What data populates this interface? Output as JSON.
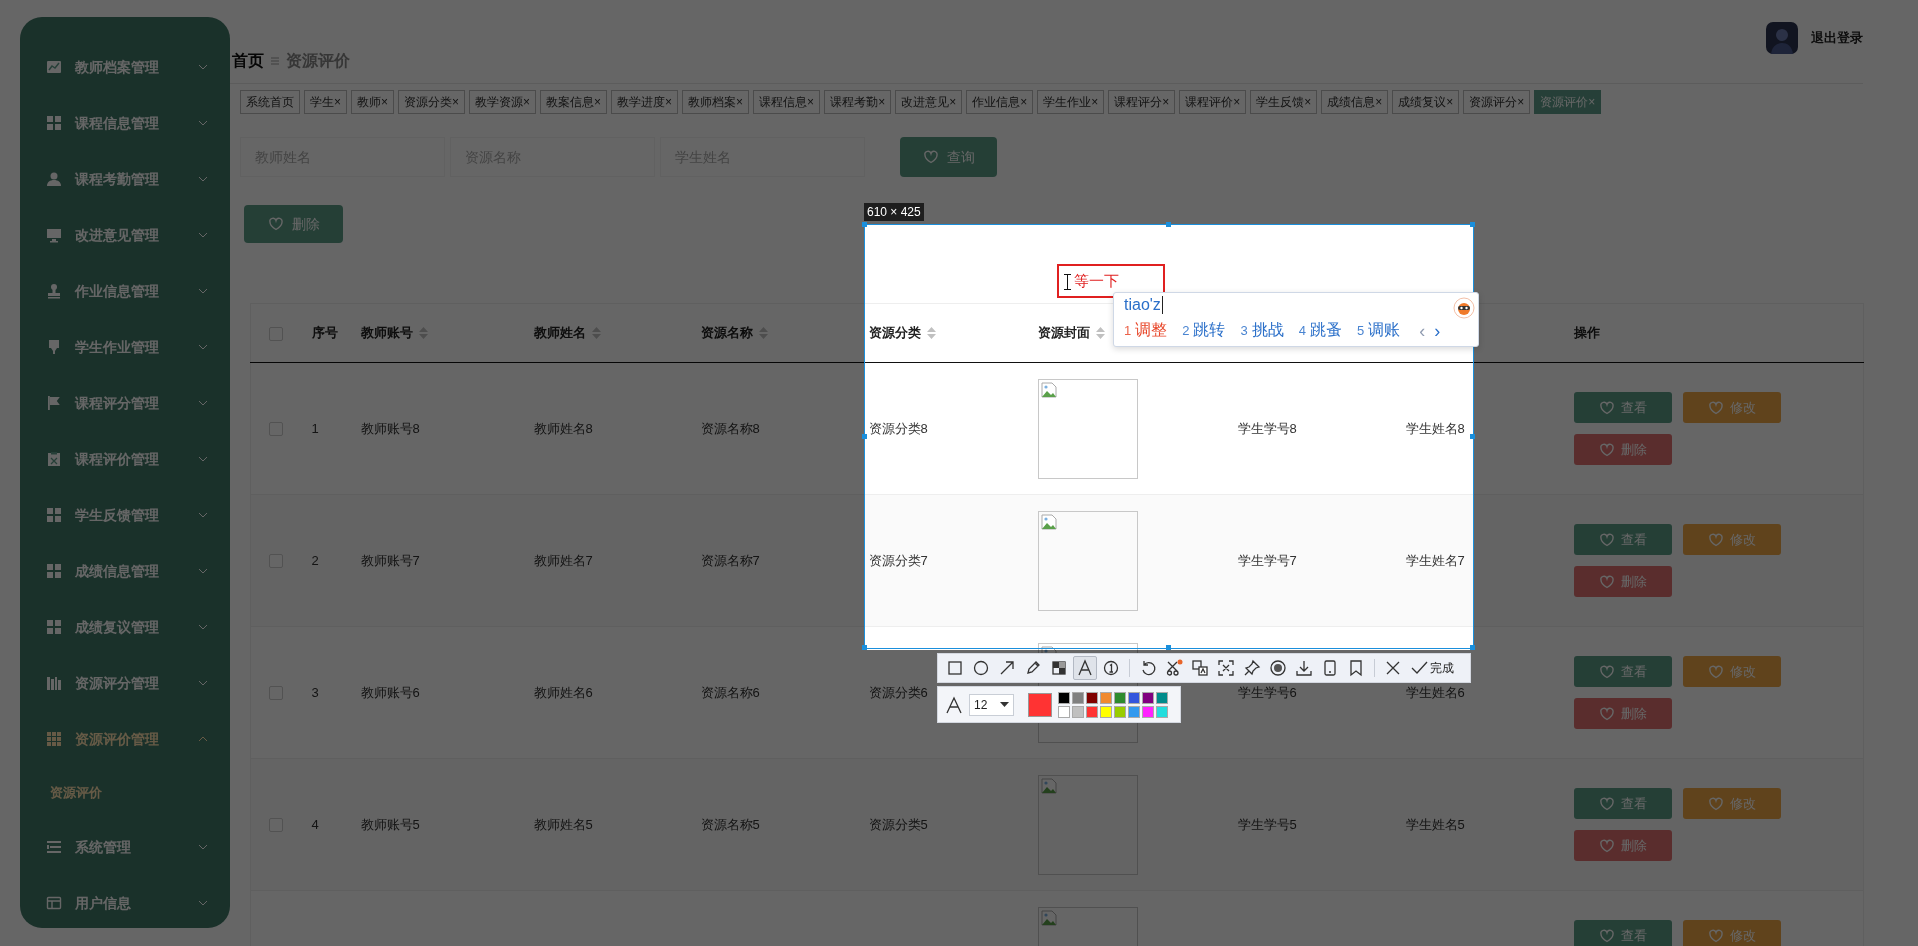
{
  "sidebar": {
    "items": [
      {
        "label": "教师档案管理",
        "expanded": false,
        "selected": false
      },
      {
        "label": "课程信息管理",
        "expanded": false,
        "selected": false
      },
      {
        "label": "课程考勤管理",
        "expanded": false,
        "selected": false
      },
      {
        "label": "改进意见管理",
        "expanded": false,
        "selected": false
      },
      {
        "label": "作业信息管理",
        "expanded": false,
        "selected": false
      },
      {
        "label": "学生作业管理",
        "expanded": false,
        "selected": false
      },
      {
        "label": "课程评分管理",
        "expanded": false,
        "selected": false
      },
      {
        "label": "课程评价管理",
        "expanded": false,
        "selected": false
      },
      {
        "label": "学生反馈管理",
        "expanded": false,
        "selected": false
      },
      {
        "label": "成绩信息管理",
        "expanded": false,
        "selected": false
      },
      {
        "label": "成绩复议管理",
        "expanded": false,
        "selected": false
      },
      {
        "label": "资源评分管理",
        "expanded": false,
        "selected": false
      },
      {
        "label": "资源评价管理",
        "expanded": true,
        "selected": true,
        "children": [
          {
            "label": "资源评价",
            "selected": true
          }
        ]
      },
      {
        "label": "系统管理",
        "expanded": false,
        "selected": false
      },
      {
        "label": "用户信息",
        "expanded": false,
        "selected": false
      }
    ]
  },
  "header": {
    "breadcrumb": [
      "首页",
      "资源评价"
    ],
    "logout": "退出登录"
  },
  "tabs": [
    {
      "label": "系统首页",
      "selected": false
    },
    {
      "label": "学生",
      "close": "×",
      "selected": false
    },
    {
      "label": "教师",
      "close": "×",
      "selected": false
    },
    {
      "label": "资源分类",
      "close": "×",
      "selected": false
    },
    {
      "label": "教学资源",
      "close": "×",
      "selected": false
    },
    {
      "label": "教案信息",
      "close": "×",
      "selected": false
    },
    {
      "label": "教学进度",
      "close": "×",
      "selected": false
    },
    {
      "label": "教师档案",
      "close": "×",
      "selected": false
    },
    {
      "label": "课程信息",
      "close": "×",
      "selected": false
    },
    {
      "label": "课程考勤",
      "close": "×",
      "selected": false
    },
    {
      "label": "改进意见",
      "close": "×",
      "selected": false
    },
    {
      "label": "作业信息",
      "close": "×",
      "selected": false
    },
    {
      "label": "学生作业",
      "close": "×",
      "selected": false
    },
    {
      "label": "课程评分",
      "close": "×",
      "selected": false
    },
    {
      "label": "课程评价",
      "close": "×",
      "selected": false
    },
    {
      "label": "学生反馈",
      "close": "×",
      "selected": false
    },
    {
      "label": "成绩信息",
      "close": "×",
      "selected": false
    },
    {
      "label": "成绩复议",
      "close": "×",
      "selected": false
    },
    {
      "label": "资源评分",
      "close": "×",
      "selected": false
    },
    {
      "label": "资源评价",
      "close": "×",
      "selected": true
    }
  ],
  "search": {
    "fields": [
      {
        "placeholder": "教师姓名"
      },
      {
        "placeholder": "资源名称"
      },
      {
        "placeholder": "学生姓名"
      }
    ],
    "button": "查询"
  },
  "delete_button": "删除",
  "table": {
    "checked": false,
    "columns": [
      {
        "label": "序号",
        "sortable": false
      },
      {
        "label": "教师账号",
        "sortable": true
      },
      {
        "label": "教师姓名",
        "sortable": true
      },
      {
        "label": "资源名称",
        "sortable": true
      },
      {
        "label": "资源分类",
        "sortable": true
      },
      {
        "label": "资源封面",
        "sortable": true
      },
      null,
      null,
      {
        "label": "操作",
        "sortable": false
      }
    ],
    "rows": [
      {
        "checked": false,
        "index": "1",
        "teacher_account": "教师账号8",
        "teacher_name": "教师姓名8",
        "resource_name": "资源名称8",
        "category": "资源分类8",
        "student_no": "学生学号8",
        "student_name": "学生姓名8",
        "actions": [
          {
            "kind": "view",
            "label": "查看"
          },
          {
            "kind": "edit",
            "label": "修改"
          },
          {
            "kind": "delete",
            "label": "删除"
          }
        ]
      },
      {
        "checked": false,
        "index": "2",
        "teacher_account": "教师账号7",
        "teacher_name": "教师姓名7",
        "resource_name": "资源名称7",
        "category": "资源分类7",
        "student_no": "学生学号7",
        "student_name": "学生姓名7",
        "actions": [
          {
            "kind": "view",
            "label": "查看"
          },
          {
            "kind": "edit",
            "label": "修改"
          },
          {
            "kind": "delete",
            "label": "删除"
          }
        ]
      },
      {
        "checked": false,
        "index": "3",
        "teacher_account": "教师账号6",
        "teacher_name": "教师姓名6",
        "resource_name": "资源名称6",
        "category": "资源分类6",
        "student_no": "学生学号6",
        "student_name": "学生姓名6",
        "actions": [
          {
            "kind": "view",
            "label": "查看"
          },
          {
            "kind": "edit",
            "label": "修改"
          },
          {
            "kind": "delete",
            "label": "删除"
          }
        ]
      },
      {
        "checked": false,
        "index": "4",
        "teacher_account": "教师账号5",
        "teacher_name": "教师姓名5",
        "resource_name": "资源名称5",
        "category": "资源分类5",
        "student_no": "学生学号5",
        "student_name": "学生姓名5",
        "actions": [
          {
            "kind": "view",
            "label": "查看"
          },
          {
            "kind": "edit",
            "label": "修改"
          },
          {
            "kind": "delete",
            "label": "删除"
          }
        ]
      },
      {
        "actions": [
          {
            "kind": "view",
            "label": "查看"
          },
          {
            "kind": "edit",
            "label": "修改"
          }
        ]
      }
    ]
  },
  "screenshot_tool": {
    "size_label": "610 × 425",
    "annotation": {
      "text": "等一下",
      "color": "#e02020"
    },
    "tool_groups": [
      [
        {
          "kind": "rectangle",
          "selected": false
        },
        {
          "kind": "ellipse",
          "selected": false
        },
        {
          "kind": "arrow",
          "selected": false
        },
        {
          "kind": "pencil",
          "selected": false
        },
        {
          "kind": "mosaic",
          "selected": false
        },
        {
          "kind": "text",
          "selected": true
        },
        {
          "kind": "number",
          "selected": false
        }
      ],
      [
        {
          "kind": "undo",
          "selected": false
        },
        {
          "kind": "scissors",
          "selected": false
        },
        {
          "kind": "translate",
          "selected": false
        },
        {
          "kind": "ocr",
          "selected": false
        },
        {
          "kind": "pin",
          "selected": false
        },
        {
          "kind": "record",
          "selected": false
        },
        {
          "kind": "download",
          "selected": false
        },
        {
          "kind": "phone",
          "selected": false
        },
        {
          "kind": "bookmark",
          "selected": false
        }
      ],
      [
        {
          "kind": "close",
          "selected": false
        },
        {
          "kind": "done",
          "label": "完成",
          "selected": false
        }
      ]
    ],
    "text_options": {
      "font_size": "12",
      "color": "#ff3333",
      "palette": [
        {
          "color": "#000000"
        },
        {
          "color": "#808080"
        },
        {
          "color": "#800000"
        },
        {
          "color": "#f08a30"
        },
        {
          "color": "#2e8b2e"
        },
        {
          "color": "#3355dd"
        },
        {
          "color": "#800080"
        },
        {
          "color": "#008b8b"
        },
        {
          "color": "#ffffff"
        },
        {
          "color": "#c0c0c0"
        },
        {
          "color": "#ff3333"
        },
        {
          "color": "#ffff00"
        },
        {
          "color": "#99cc00"
        },
        {
          "color": "#3399ee"
        },
        {
          "color": "#ff22ff"
        },
        {
          "color": "#22dddd"
        }
      ]
    }
  },
  "ime": {
    "input": "tiao'z",
    "candidates": [
      {
        "number": "1",
        "text": "调整",
        "selected": true
      },
      {
        "number": "2",
        "text": "跳转",
        "selected": false
      },
      {
        "number": "3",
        "text": "挑战",
        "selected": false
      },
      {
        "number": "4",
        "text": "跳蚤",
        "selected": false
      },
      {
        "number": "5",
        "text": "调账",
        "selected": false
      }
    ],
    "prev": {
      "glyph": "‹",
      "disabled": true
    },
    "next": {
      "glyph": "›",
      "disabled": false
    }
  }
}
